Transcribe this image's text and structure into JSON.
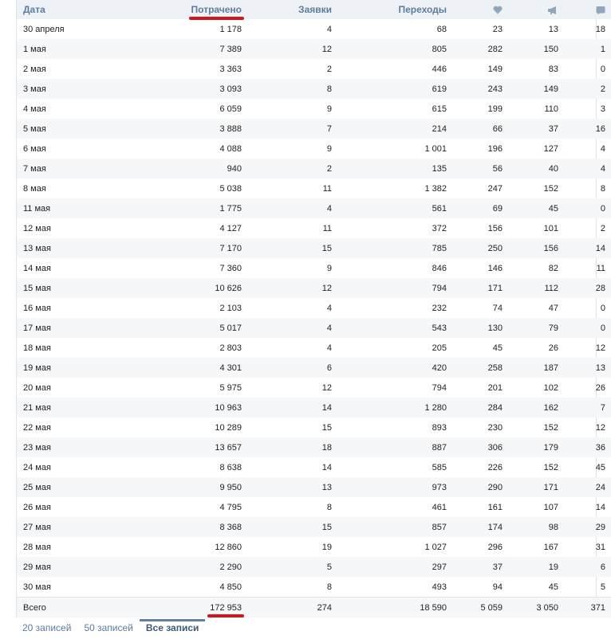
{
  "headers": {
    "date": "Дата",
    "spent": "Потрачено",
    "requests": "Заявки",
    "clicks": "Переходы",
    "like_icon": "heart-icon",
    "share_icon": "megaphone-icon",
    "comment_icon": "comment-icon"
  },
  "rows": [
    {
      "date": "30 апреля",
      "spent": "1 178",
      "requests": "4",
      "clicks": "68",
      "likes": "23",
      "shares": "13",
      "comments": "18"
    },
    {
      "date": "1 мая",
      "spent": "7 389",
      "requests": "12",
      "clicks": "805",
      "likes": "282",
      "shares": "150",
      "comments": "1"
    },
    {
      "date": "2 мая",
      "spent": "3 363",
      "requests": "2",
      "clicks": "446",
      "likes": "149",
      "shares": "83",
      "comments": "0"
    },
    {
      "date": "3 мая",
      "spent": "3 093",
      "requests": "8",
      "clicks": "619",
      "likes": "243",
      "shares": "149",
      "comments": "2"
    },
    {
      "date": "4 мая",
      "spent": "6 059",
      "requests": "9",
      "clicks": "615",
      "likes": "199",
      "shares": "110",
      "comments": "3"
    },
    {
      "date": "5 мая",
      "spent": "3 888",
      "requests": "7",
      "clicks": "214",
      "likes": "66",
      "shares": "37",
      "comments": "16"
    },
    {
      "date": "6 мая",
      "spent": "4 088",
      "requests": "9",
      "clicks": "1 001",
      "likes": "196",
      "shares": "127",
      "comments": "4"
    },
    {
      "date": "7 мая",
      "spent": "940",
      "requests": "2",
      "clicks": "135",
      "likes": "56",
      "shares": "40",
      "comments": "4"
    },
    {
      "date": "8 мая",
      "spent": "5 038",
      "requests": "11",
      "clicks": "1 382",
      "likes": "247",
      "shares": "152",
      "comments": "8"
    },
    {
      "date": "11 мая",
      "spent": "1 775",
      "requests": "4",
      "clicks": "561",
      "likes": "69",
      "shares": "45",
      "comments": "0"
    },
    {
      "date": "12 мая",
      "spent": "4 127",
      "requests": "11",
      "clicks": "372",
      "likes": "156",
      "shares": "101",
      "comments": "2"
    },
    {
      "date": "13 мая",
      "spent": "7 170",
      "requests": "15",
      "clicks": "785",
      "likes": "250",
      "shares": "156",
      "comments": "14"
    },
    {
      "date": "14 мая",
      "spent": "7 360",
      "requests": "9",
      "clicks": "846",
      "likes": "146",
      "shares": "82",
      "comments": "11"
    },
    {
      "date": "15 мая",
      "spent": "10 626",
      "requests": "12",
      "clicks": "794",
      "likes": "171",
      "shares": "112",
      "comments": "28"
    },
    {
      "date": "16 мая",
      "spent": "2 103",
      "requests": "4",
      "clicks": "232",
      "likes": "74",
      "shares": "47",
      "comments": "0"
    },
    {
      "date": "17 мая",
      "spent": "5 017",
      "requests": "4",
      "clicks": "543",
      "likes": "130",
      "shares": "79",
      "comments": "0"
    },
    {
      "date": "18 мая",
      "spent": "2 803",
      "requests": "4",
      "clicks": "205",
      "likes": "45",
      "shares": "26",
      "comments": "12"
    },
    {
      "date": "19 мая",
      "spent": "4 301",
      "requests": "6",
      "clicks": "420",
      "likes": "258",
      "shares": "187",
      "comments": "13"
    },
    {
      "date": "20 мая",
      "spent": "5 975",
      "requests": "12",
      "clicks": "794",
      "likes": "201",
      "shares": "102",
      "comments": "26"
    },
    {
      "date": "21 мая",
      "spent": "10 963",
      "requests": "14",
      "clicks": "1 280",
      "likes": "284",
      "shares": "162",
      "comments": "7"
    },
    {
      "date": "22 мая",
      "spent": "10 289",
      "requests": "15",
      "clicks": "893",
      "likes": "230",
      "shares": "152",
      "comments": "12"
    },
    {
      "date": "23 мая",
      "spent": "13 657",
      "requests": "18",
      "clicks": "887",
      "likes": "306",
      "shares": "179",
      "comments": "36"
    },
    {
      "date": "24 мая",
      "spent": "8 638",
      "requests": "14",
      "clicks": "585",
      "likes": "226",
      "shares": "152",
      "comments": "45"
    },
    {
      "date": "25 мая",
      "spent": "9 950",
      "requests": "13",
      "clicks": "973",
      "likes": "290",
      "shares": "171",
      "comments": "24"
    },
    {
      "date": "26 мая",
      "spent": "4 795",
      "requests": "8",
      "clicks": "461",
      "likes": "161",
      "shares": "107",
      "comments": "14"
    },
    {
      "date": "27 мая",
      "spent": "8 368",
      "requests": "15",
      "clicks": "857",
      "likes": "174",
      "shares": "98",
      "comments": "29"
    },
    {
      "date": "28 мая",
      "spent": "12 860",
      "requests": "19",
      "clicks": "1 027",
      "likes": "296",
      "shares": "167",
      "comments": "31"
    },
    {
      "date": "29 мая",
      "spent": "2 290",
      "requests": "5",
      "clicks": "297",
      "likes": "37",
      "shares": "19",
      "comments": "6"
    },
    {
      "date": "30 мая",
      "spent": "4 850",
      "requests": "8",
      "clicks": "493",
      "likes": "94",
      "shares": "45",
      "comments": "5"
    }
  ],
  "totals": {
    "label": "Всего",
    "spent": "172 953",
    "requests": "274",
    "clicks": "18 590",
    "likes": "5 059",
    "shares": "3 050",
    "comments": "371"
  },
  "pager": [
    {
      "label": "20 записей",
      "active": false
    },
    {
      "label": "50 записей",
      "active": false
    },
    {
      "label": "Все записи",
      "active": true
    }
  ],
  "colors": {
    "header_text": "#5c7d9e",
    "header_bg": "#eef1f5",
    "stripe_bg": "#f6f7f9",
    "highlight_red": "#d6141a",
    "icon": "#8fa6be"
  }
}
